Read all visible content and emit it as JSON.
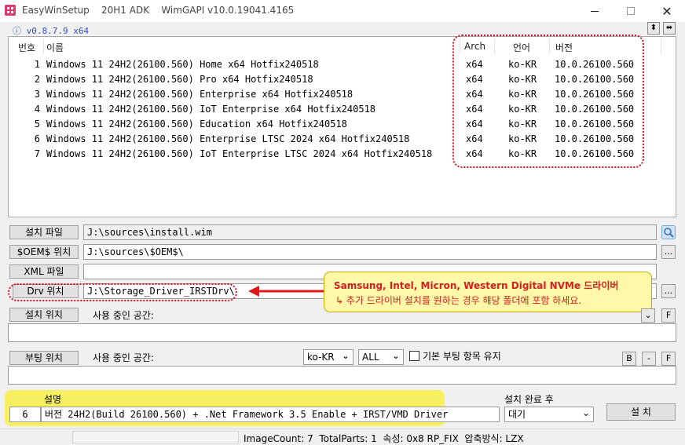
{
  "window": {
    "title": "EasyWinSetup    20H1 ADK    WimGAPI v10.0.19041.4165"
  },
  "version_label": "ⓘ v0.8.7.9 x64",
  "list": {
    "headers": {
      "num": "번호",
      "name": "이름",
      "arch": "Arch",
      "lang": "언어",
      "ver": "버전"
    },
    "rows": [
      {
        "num": "1",
        "name": "Windows 11 24H2(26100.560) Home x64 Hotfix240518",
        "arch": "x64",
        "lang": "ko-KR",
        "ver": "10.0.26100.560"
      },
      {
        "num": "2",
        "name": "Windows 11 24H2(26100.560) Pro x64 Hotfix240518",
        "arch": "x64",
        "lang": "ko-KR",
        "ver": "10.0.26100.560"
      },
      {
        "num": "3",
        "name": "Windows 11 24H2(26100.560) Enterprise x64 Hotfix240518",
        "arch": "x64",
        "lang": "ko-KR",
        "ver": "10.0.26100.560"
      },
      {
        "num": "4",
        "name": "Windows 11 24H2(26100.560) IoT Enterprise x64 Hotfix240518",
        "arch": "x64",
        "lang": "ko-KR",
        "ver": "10.0.26100.560"
      },
      {
        "num": "5",
        "name": "Windows 11 24H2(26100.560) Education x64 Hotfix240518",
        "arch": "x64",
        "lang": "ko-KR",
        "ver": "10.0.26100.560"
      },
      {
        "num": "6",
        "name": "Windows 11 24H2(26100.560) Enterprise LTSC 2024 x64 Hotfix240518",
        "arch": "x64",
        "lang": "ko-KR",
        "ver": "10.0.26100.560"
      },
      {
        "num": "7",
        "name": "Windows 11 24H2(26100.560) IoT Enterprise LTSC 2024 x64 Hotfix240518",
        "arch": "x64",
        "lang": "ko-KR",
        "ver": "10.0.26100.560"
      }
    ]
  },
  "install_file": {
    "label": "설치 파일",
    "value": "J:\\sources\\install.wim"
  },
  "oem": {
    "label": "$OEM$ 위치",
    "value": "J:\\sources\\$OEM$\\",
    "browse": "..."
  },
  "xml": {
    "label": "XML 파일",
    "value": ""
  },
  "drv": {
    "label": "Drv 위치",
    "value": "J:\\Storage_Driver_IRSTDrv\\",
    "browse": "..."
  },
  "callout": {
    "line1": "Samsung, Intel, Micron, Western Digital NVMe 드라이버",
    "line2": "↳ 추가 드라이버 설치를 원하는 경우 해당 폴더에 포함 하세요."
  },
  "install_location": {
    "label": "설치 위치",
    "used_space": "사용 중인 공간:",
    "f_button": "F"
  },
  "boot_location": {
    "label": "부팅 위치",
    "used_space": "사용 중인 공간:",
    "lang_select": "ko-KR",
    "scope_select": "ALL",
    "keep_label": "기본 부팅 항목 유지",
    "b_button": "B",
    "minus_button": "-",
    "f_button": "F"
  },
  "description": {
    "header": "설명",
    "index": "6",
    "text": "버전 24H2(Build 26100.560) + .Net Framework 3.5 Enable + IRST/VMD Driver"
  },
  "after_install": {
    "label": "설치 완료 후",
    "value": "대기"
  },
  "install_button": "설 치",
  "status": "ImageCount: 7  TotalParts: 1  속성: 0x8 RP_FIX  압축방식: LZX"
}
